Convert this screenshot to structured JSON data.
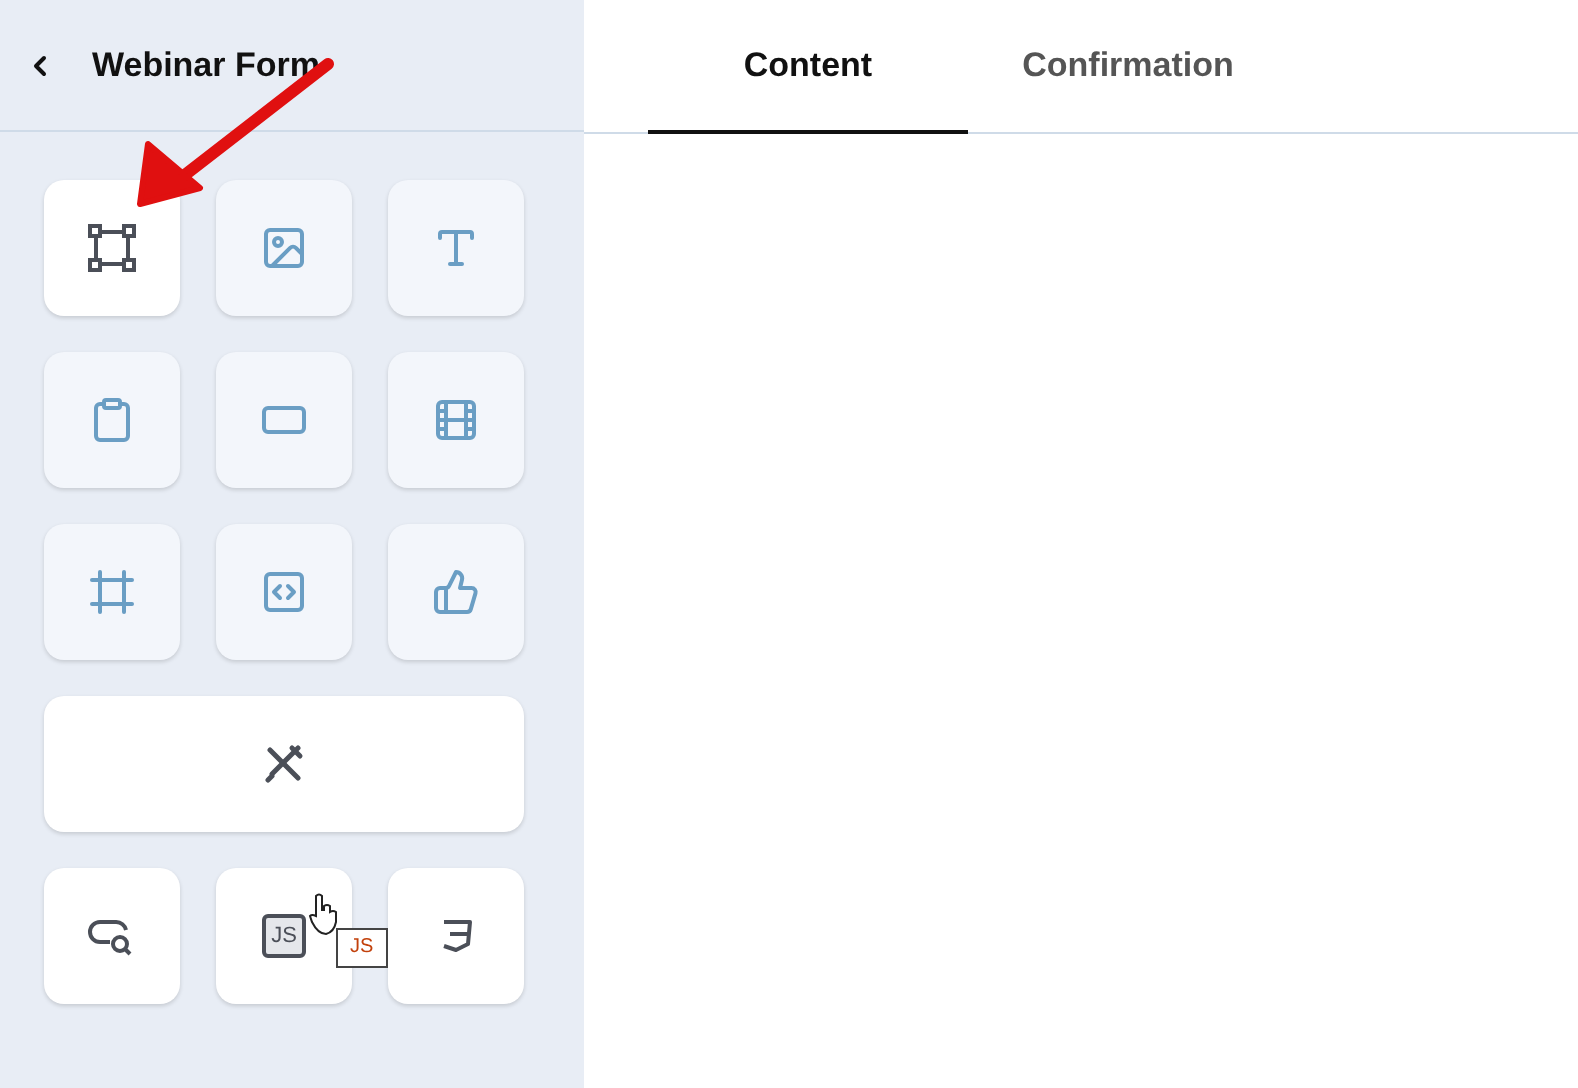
{
  "sidebar": {
    "title": "Webinar Form",
    "tiles": [
      {
        "kind": "frame",
        "enabled": true
      },
      {
        "kind": "image",
        "enabled": false
      },
      {
        "kind": "text",
        "enabled": false
      },
      {
        "kind": "clipboard",
        "enabled": false
      },
      {
        "kind": "rectangle",
        "enabled": false
      },
      {
        "kind": "film",
        "enabled": false
      },
      {
        "kind": "crop",
        "enabled": false
      },
      {
        "kind": "code",
        "enabled": false
      },
      {
        "kind": "like",
        "enabled": false
      },
      {
        "kind": "tools",
        "enabled": true
      },
      {
        "kind": "search",
        "enabled": true
      },
      {
        "kind": "js",
        "enabled": true,
        "label": "JS",
        "tooltip": "JS"
      },
      {
        "kind": "css",
        "enabled": true
      }
    ]
  },
  "tabs": [
    {
      "label": "Content",
      "selected": true
    },
    {
      "label": "Confirmation",
      "selected": false
    }
  ]
}
